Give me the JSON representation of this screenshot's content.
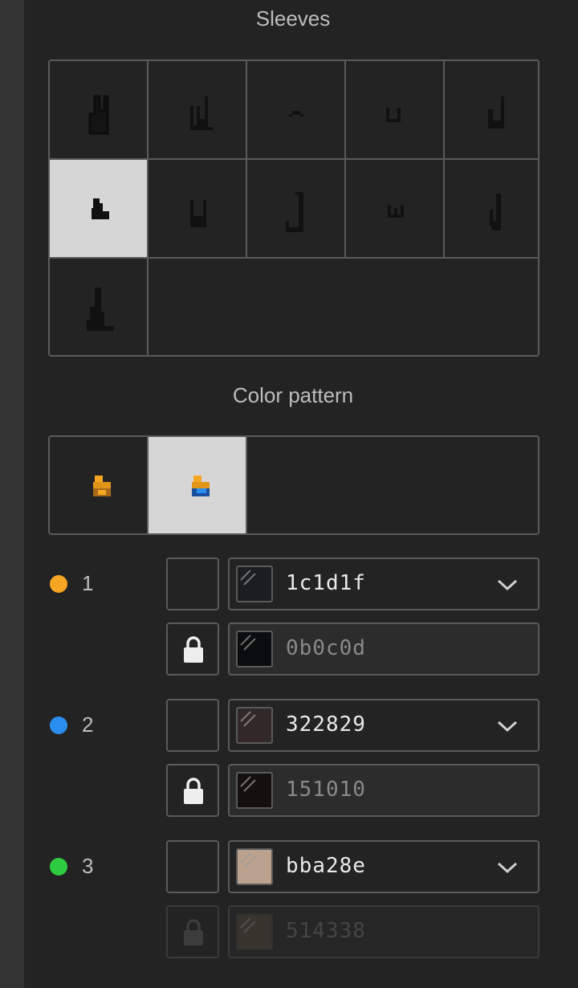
{
  "sleeves": {
    "title": "Sleeves",
    "items": [
      "sleeve-1",
      "sleeve-2",
      "sleeve-3",
      "sleeve-4",
      "sleeve-5",
      "sleeve-6",
      "sleeve-7",
      "sleeve-8",
      "sleeve-9",
      "sleeve-10",
      "sleeve-11"
    ],
    "selected_index": 5
  },
  "color_pattern": {
    "title": "Color pattern",
    "items": [
      "pattern-1",
      "pattern-2"
    ],
    "selected_index": 1
  },
  "colors": [
    {
      "number": "1",
      "dot_color": "#f5a623",
      "primary_hex": "1c1d1f",
      "primary_color": "#1c1d1f",
      "secondary_hex": "0b0c0d",
      "secondary_color": "#0b0c0d",
      "secondary_disabled": false
    },
    {
      "number": "2",
      "dot_color": "#2a8ef0",
      "primary_hex": "322829",
      "primary_color": "#322829",
      "secondary_hex": "151010",
      "secondary_color": "#151010",
      "secondary_disabled": false
    },
    {
      "number": "3",
      "dot_color": "#2ecc40",
      "primary_hex": "bba28e",
      "primary_color": "#bba28e",
      "secondary_hex": "514338",
      "secondary_color": "#514338",
      "secondary_disabled": true
    }
  ],
  "icons": {
    "lock": "lock-icon",
    "dropdown": "chevron-down-icon",
    "sleeve": "sleeve-sprite-icon",
    "pattern": "pattern-sprite-icon"
  }
}
